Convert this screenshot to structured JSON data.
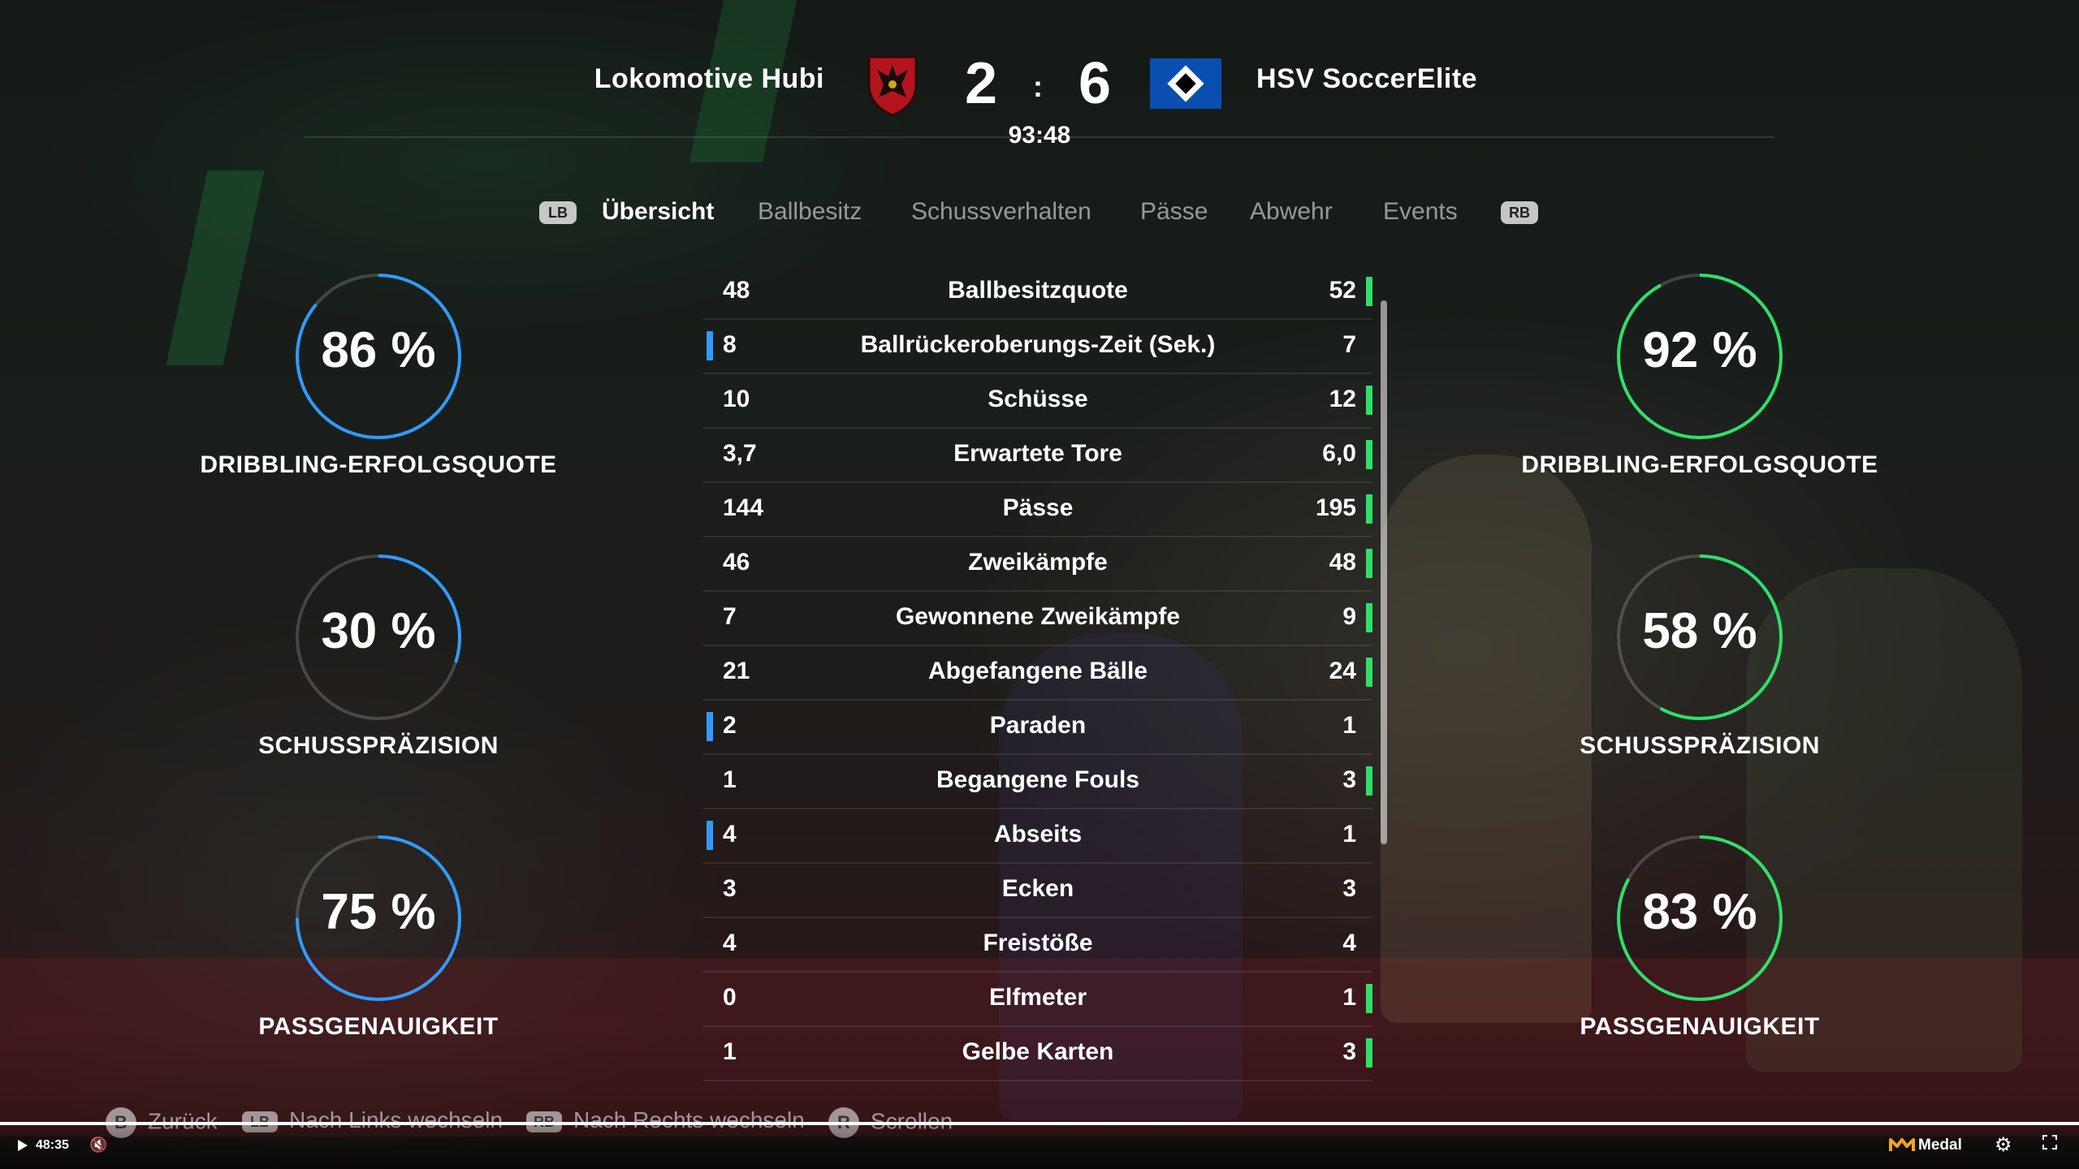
{
  "header": {
    "home_team": "Lokomotive Hubi",
    "away_team": "HSV SoccerElite",
    "home_score": "2",
    "separator": ":",
    "away_score": "6",
    "clock": "93:48"
  },
  "tabs": {
    "left_shoulder": "LB",
    "right_shoulder": "RB",
    "items": [
      "Übersicht",
      "Ballbesitz",
      "Schussverhalten",
      "Pässe",
      "Abwehr",
      "Events"
    ],
    "active": "Übersicht"
  },
  "home_stats": [
    {
      "value": "86 %",
      "percent": 86,
      "label": "DRIBBLING-ERFOLGSQUOTE"
    },
    {
      "value": "30 %",
      "percent": 30,
      "label": "SCHUSSPRÄZISION"
    },
    {
      "value": "75 %",
      "percent": 75,
      "label": "PASSGENAUIGKEIT"
    }
  ],
  "away_stats": [
    {
      "value": "92 %",
      "percent": 92,
      "label": "DRIBBLING-ERFOLGSQUOTE"
    },
    {
      "value": "58 %",
      "percent": 58,
      "label": "SCHUSSPRÄZISION"
    },
    {
      "value": "83 %",
      "percent": 83,
      "label": "PASSGENAUIGKEIT"
    }
  ],
  "stat_rows": [
    {
      "label": "Ballbesitzquote",
      "home": "48",
      "away": "52",
      "leader": "away"
    },
    {
      "label": "Ballrückeroberungs-Zeit (Sek.)",
      "home": "8",
      "away": "7",
      "leader": "home"
    },
    {
      "label": "Schüsse",
      "home": "10",
      "away": "12",
      "leader": "away"
    },
    {
      "label": "Erwartete Tore",
      "home": "3,7",
      "away": "6,0",
      "leader": "away"
    },
    {
      "label": "Pässe",
      "home": "144",
      "away": "195",
      "leader": "away"
    },
    {
      "label": "Zweikämpfe",
      "home": "46",
      "away": "48",
      "leader": "away"
    },
    {
      "label": "Gewonnene Zweikämpfe",
      "home": "7",
      "away": "9",
      "leader": "away"
    },
    {
      "label": "Abgefangene Bälle",
      "home": "21",
      "away": "24",
      "leader": "away"
    },
    {
      "label": "Paraden",
      "home": "2",
      "away": "1",
      "leader": "home"
    },
    {
      "label": "Begangene Fouls",
      "home": "1",
      "away": "3",
      "leader": "away"
    },
    {
      "label": "Abseits",
      "home": "4",
      "away": "1",
      "leader": "home"
    },
    {
      "label": "Ecken",
      "home": "3",
      "away": "3",
      "leader": "none"
    },
    {
      "label": "Freistöße",
      "home": "4",
      "away": "4",
      "leader": "none"
    },
    {
      "label": "Elfmeter",
      "home": "0",
      "away": "1",
      "leader": "away"
    },
    {
      "label": "Gelbe Karten",
      "home": "1",
      "away": "3",
      "leader": "away"
    }
  ],
  "hints": {
    "back_button": "B",
    "back": "Zurück",
    "left_button": "LB",
    "left": "Nach Links wechseln",
    "right_button": "RB",
    "right": "Nach Rechts wechseln",
    "scroll_button": "R",
    "scroll": "Scrollen"
  },
  "player": {
    "time": "48:35",
    "progress": 1.0,
    "brand": "Medal"
  },
  "colors": {
    "home_accent": "#2f9bff",
    "away_accent": "#2ee06a",
    "ring_track": "rgba(255,255,255,0.18)"
  },
  "icons": {
    "home_crest": "red-eagle-shield-icon",
    "away_crest": "blue-diamond-flag-icon",
    "play": "play-icon",
    "mute": "speaker-muted-icon",
    "settings": "gear-icon",
    "fullscreen": "fullscreen-icon"
  }
}
